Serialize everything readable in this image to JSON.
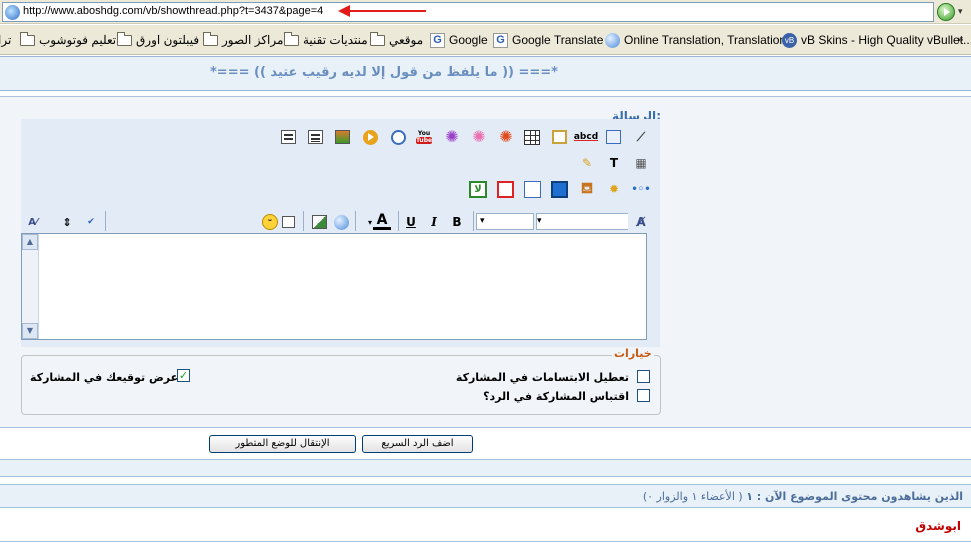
{
  "browser": {
    "url": "http://www.aboshdg.com/vb/showthread.php?t=3437&page=4",
    "bookmarks": [
      "تعليم فوتوشوب",
      "فيبلتون اورق",
      "مراكز الصور",
      "منتديات تقنية",
      "موقعي",
      "Google",
      "Google Translate",
      "Online Translation, Translation...",
      "vB Skins - High Quality vBullet..."
    ],
    "bookmark_truncated_left": "ترا"
  },
  "thread": {
    "title": "*=== (( ما يلفظ من قول إلا لديه رقيب عتيد )) ===*"
  },
  "quick_reply": {
    "message_label": "الرسالة:",
    "options_legend": "خيارات",
    "option_disable_smilies": "تعطيل الابتسامات في المشاركة",
    "option_quote_post": "اقتباس المشاركة في الرد؟",
    "option_show_signature": "عرض توقيعك في المشاركة",
    "show_signature_checked": "✓",
    "submit_label": "اضف الرد السريع",
    "advanced_label": "الإنتقال للوضع المتطور"
  },
  "toolbar": {
    "bold": "B",
    "italic": "I",
    "underline": "U",
    "font_color": "A",
    "letters_t": "T",
    "abcd": "abcd",
    "youtube_top": "You",
    "youtube_bottom": "Tube",
    "green_btn": "لا"
  },
  "viewers": {
    "heading": "الذين يشاهدون محتوى الموضوع الآن : ١",
    "breakdown": "( الأعضاء ١ والزوار ٠)",
    "members": [
      "ابوشدق"
    ]
  },
  "colors": {
    "accent": "#3b6eaa",
    "legend": "#c85a12",
    "member_name": "#c00000"
  }
}
